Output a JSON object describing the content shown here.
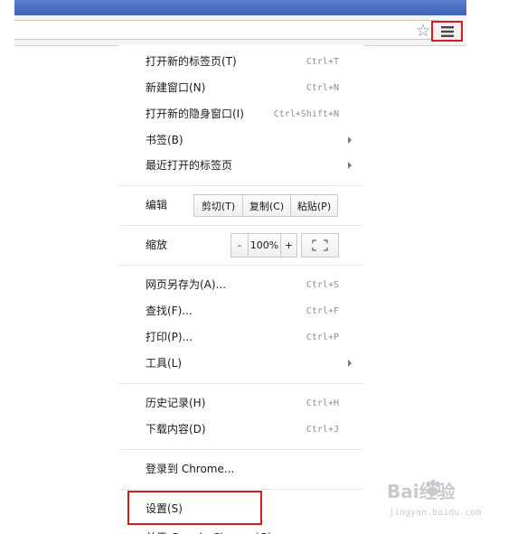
{
  "menu": {
    "section1": [
      {
        "label": "打开新的标签页(T)",
        "shortcut": "Ctrl+T",
        "submenu": false
      },
      {
        "label": "新建窗口(N)",
        "shortcut": "Ctrl+N",
        "submenu": false
      },
      {
        "label": "打开新的隐身窗口(I)",
        "shortcut": "Ctrl+Shift+N",
        "submenu": false
      },
      {
        "label": "书签(B)",
        "shortcut": "",
        "submenu": true
      },
      {
        "label": "最近打开的标签页",
        "shortcut": "",
        "submenu": true
      }
    ],
    "edit": {
      "label": "编辑",
      "cut": "剪切(T)",
      "copy": "复制(C)",
      "paste": "粘贴(P)"
    },
    "zoom": {
      "label": "缩放",
      "minus": "-",
      "level": "100%",
      "plus": "+"
    },
    "section2": [
      {
        "label": "网页另存为(A)...",
        "shortcut": "Ctrl+S",
        "submenu": false
      },
      {
        "label": "查找(F)...",
        "shortcut": "Ctrl+F",
        "submenu": false
      },
      {
        "label": "打印(P)...",
        "shortcut": "Ctrl+P",
        "submenu": false
      },
      {
        "label": "工具(L)",
        "shortcut": "",
        "submenu": true
      }
    ],
    "section3": [
      {
        "label": "历史记录(H)",
        "shortcut": "Ctrl+H"
      },
      {
        "label": "下载内容(D)",
        "shortcut": "Ctrl+J"
      }
    ],
    "signin": {
      "label": "登录到 Chrome..."
    },
    "settings": {
      "label": "设置(S)"
    },
    "about": {
      "label": "关于 Google Chrome(G)"
    }
  },
  "watermark": {
    "brand": "Bai经验",
    "url": "jingyan.baidu.com"
  },
  "colors": {
    "highlight_border": "#d31c1c",
    "title_bar": "#4a6fc4",
    "shortcut_text": "#8e8e8e"
  },
  "icons": {
    "bookmark_star": "star-icon",
    "menu": "hamburger-menu-icon"
  }
}
